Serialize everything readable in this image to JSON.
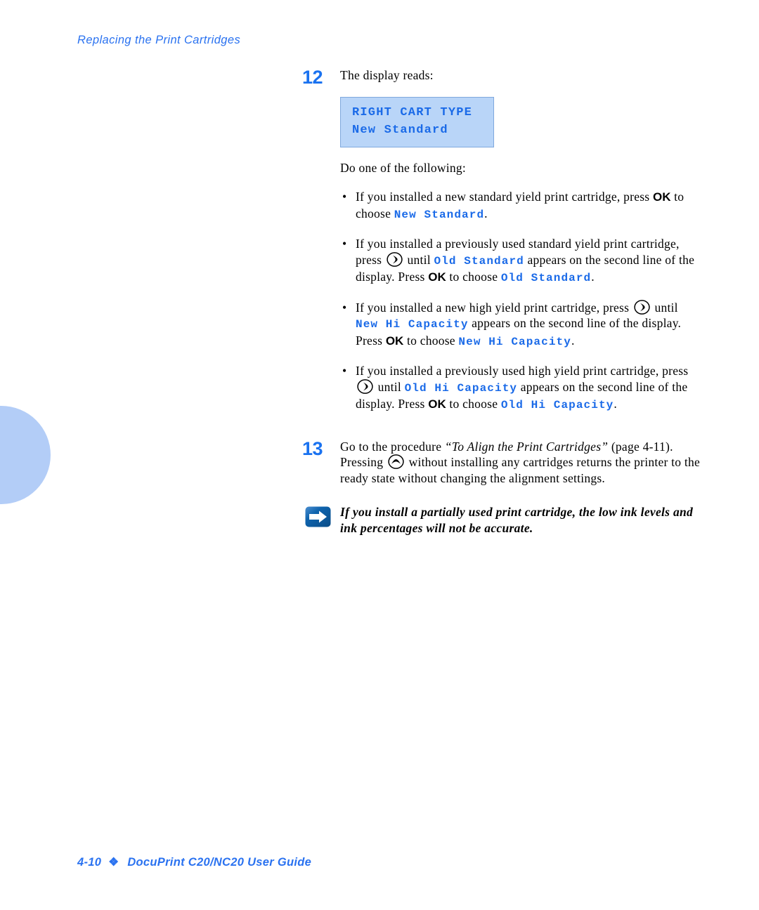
{
  "header": {
    "running_head": "Replacing the Print Cartridges"
  },
  "footer": {
    "page_number": "4-10",
    "diamond": "❖",
    "guide_title": "DocuPrint C20/NC20 User Guide"
  },
  "icons": {
    "right_button": "right-arrow-button-icon",
    "up_button": "up-arrow-button-icon",
    "note": "note-arrow-icon"
  },
  "colors": {
    "accent_blue": "#2a72f0",
    "mono_blue": "#1a6ae8",
    "lcd_fill": "#b9d5f8",
    "lcd_border": "#7fa8dd",
    "thumb_tab": "#b3cdf7",
    "note_icon_blue": "#0e5ea8"
  },
  "steps": [
    {
      "number": "12",
      "intro": "The display reads:",
      "lcd": {
        "line1": "RIGHT CART TYPE",
        "line2": "New Standard"
      },
      "after_lcd": "Do one of the following:",
      "bullets": [
        {
          "dot": "•",
          "parts": [
            {
              "t": "text",
              "v": "If you installed a new standard yield print cartridge, press "
            },
            {
              "t": "key",
              "v": "OK"
            },
            {
              "t": "text",
              "v": " to choose "
            },
            {
              "t": "mono",
              "v": "New Standard"
            },
            {
              "t": "text",
              "v": "."
            }
          ]
        },
        {
          "dot": "•",
          "parts": [
            {
              "t": "text",
              "v": "If you installed a previously used standard yield print cartridge, press "
            },
            {
              "t": "icon-right",
              "v": ""
            },
            {
              "t": "text",
              "v": " until "
            },
            {
              "t": "mono",
              "v": "Old Standard"
            },
            {
              "t": "text",
              "v": " appears on the second line of the display. Press "
            },
            {
              "t": "key",
              "v": "OK"
            },
            {
              "t": "text",
              "v": " to choose "
            },
            {
              "t": "mono",
              "v": "Old Standard"
            },
            {
              "t": "text",
              "v": "."
            }
          ]
        },
        {
          "dot": "•",
          "parts": [
            {
              "t": "text",
              "v": "If you installed a new high yield print cartridge, press "
            },
            {
              "t": "icon-right",
              "v": ""
            },
            {
              "t": "text",
              "v": " until "
            },
            {
              "t": "mono",
              "v": "New Hi Capacity"
            },
            {
              "t": "text",
              "v": " appears on the second line of the display. Press "
            },
            {
              "t": "key",
              "v": "OK"
            },
            {
              "t": "text",
              "v": " to choose "
            },
            {
              "t": "mono",
              "v": "New Hi Capacity"
            },
            {
              "t": "text",
              "v": "."
            }
          ]
        },
        {
          "dot": "•",
          "parts": [
            {
              "t": "text",
              "v": "If you installed a previously used high yield print cartridge, press "
            },
            {
              "t": "icon-right",
              "v": ""
            },
            {
              "t": "text",
              "v": " until "
            },
            {
              "t": "mono",
              "v": "Old Hi Capacity"
            },
            {
              "t": "text",
              "v": " appears on the second line of the display. Press "
            },
            {
              "t": "key",
              "v": "OK"
            },
            {
              "t": "text",
              "v": " to choose "
            },
            {
              "t": "mono",
              "v": "Old Hi Capacity"
            },
            {
              "t": "text",
              "v": "."
            }
          ]
        }
      ]
    },
    {
      "number": "13",
      "parts": [
        {
          "t": "text",
          "v": "Go to the procedure "
        },
        {
          "t": "ital",
          "v": "“To Align the Print Cartridges”"
        },
        {
          "t": "text",
          "v": " (page 4-11). Pressing "
        },
        {
          "t": "icon-up",
          "v": ""
        },
        {
          "t": "text",
          "v": " without installing any cartridges returns the printer to the ready state without changing the alignment settings."
        }
      ]
    }
  ],
  "note": {
    "text": "If you install a partially used print cartridge, the low ink levels and ink percentages will not be accurate."
  }
}
